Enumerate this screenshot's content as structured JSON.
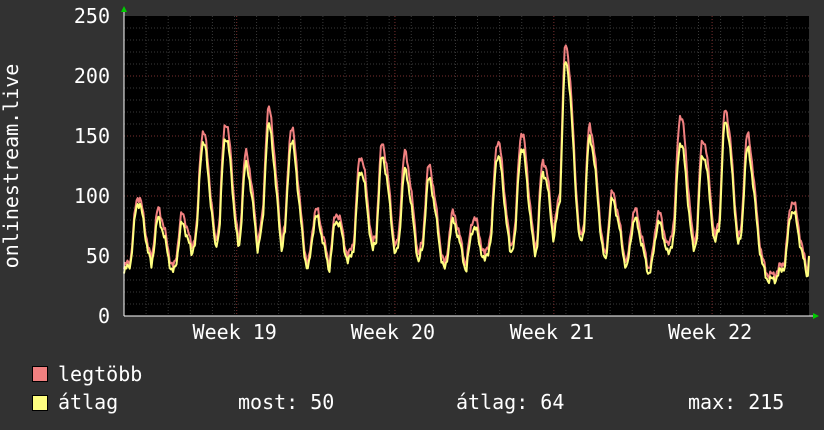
{
  "chart_data": {
    "type": "line",
    "ylabel": "onlinestream.live",
    "ylim": [
      0,
      250
    ],
    "yticks": [
      "0",
      "50",
      "100",
      "150",
      "200",
      "250"
    ],
    "x_ticks": [
      {
        "label": "Week 19",
        "pos": 0.22
      },
      {
        "label": "Week 20",
        "pos": 0.451
      },
      {
        "label": "Week 21",
        "pos": 0.683
      },
      {
        "label": "Week 22",
        "pos": 0.914
      }
    ],
    "grid": true,
    "peaks": [
      {
        "d": 0.02,
        "max": 100,
        "avg": 95
      },
      {
        "d": 0.05,
        "max": 88,
        "avg": 80
      },
      {
        "d": 0.085,
        "max": 84,
        "avg": 76
      },
      {
        "d": 0.115,
        "max": 154,
        "avg": 145
      },
      {
        "d": 0.148,
        "max": 162,
        "avg": 150
      },
      {
        "d": 0.178,
        "max": 135,
        "avg": 125
      },
      {
        "d": 0.211,
        "max": 172,
        "avg": 158
      },
      {
        "d": 0.244,
        "max": 156,
        "avg": 145
      },
      {
        "d": 0.28,
        "max": 88,
        "avg": 82
      },
      {
        "d": 0.31,
        "max": 86,
        "avg": 80
      },
      {
        "d": 0.345,
        "max": 134,
        "avg": 122
      },
      {
        "d": 0.377,
        "max": 143,
        "avg": 132
      },
      {
        "d": 0.41,
        "max": 135,
        "avg": 120
      },
      {
        "d": 0.445,
        "max": 124,
        "avg": 113
      },
      {
        "d": 0.48,
        "max": 85,
        "avg": 78
      },
      {
        "d": 0.51,
        "max": 82,
        "avg": 74
      },
      {
        "d": 0.545,
        "max": 146,
        "avg": 134
      },
      {
        "d": 0.58,
        "max": 153,
        "avg": 140
      },
      {
        "d": 0.612,
        "max": 130,
        "avg": 120
      },
      {
        "d": 0.645,
        "max": 226,
        "avg": 212
      },
      {
        "d": 0.68,
        "max": 158,
        "avg": 148
      },
      {
        "d": 0.713,
        "max": 102,
        "avg": 96
      },
      {
        "d": 0.745,
        "max": 88,
        "avg": 80
      },
      {
        "d": 0.78,
        "max": 85,
        "avg": 77
      },
      {
        "d": 0.812,
        "max": 168,
        "avg": 145
      },
      {
        "d": 0.845,
        "max": 148,
        "avg": 135
      },
      {
        "d": 0.878,
        "max": 172,
        "avg": 162
      },
      {
        "d": 0.91,
        "max": 150,
        "avg": 138
      },
      {
        "d": 0.975,
        "max": 96,
        "avg": 88
      }
    ],
    "end_value": 50,
    "legend": [
      {
        "name": "legtöbb",
        "color": "#f08080"
      },
      {
        "name": "átlag",
        "color": "#ffff80"
      }
    ]
  },
  "stats": {
    "current": "most: 50",
    "average": "átlag: 64",
    "maximum": "max: 215"
  }
}
